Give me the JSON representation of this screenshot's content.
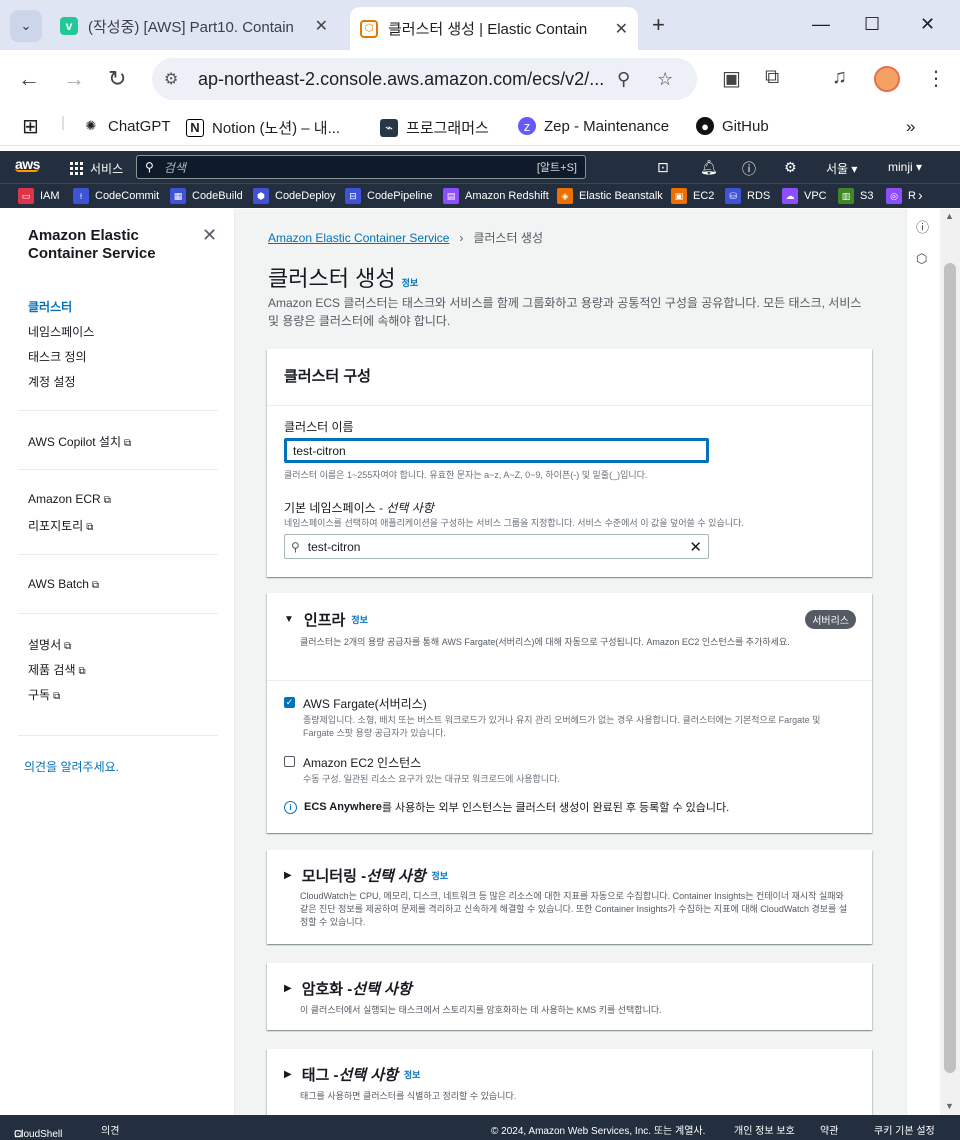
{
  "browser": {
    "tabs": [
      {
        "label": "(작성중) [AWS] Part10. Contain",
        "favicon": "velog-icon"
      },
      {
        "label": "클러스터 생성 | Elastic Contain",
        "favicon": "ecs-icon"
      }
    ],
    "url": "ap-northeast-2.console.aws.amazon.com/ecs/v2/...",
    "bookmarks": [
      "ChatGPT",
      "Notion (노션) – 내...",
      "프로그래머스",
      "Zep - Maintenance",
      "GitHub"
    ]
  },
  "aws_nav": {
    "logo": "aws",
    "services_label": "서비스",
    "search_placeholder": "검색",
    "search_shortcut": "[알트+S]",
    "region": "서울 ▾",
    "user": "minji ▾",
    "favorites": [
      "IAM",
      "CodeCommit",
      "CodeBuild",
      "CodeDeploy",
      "CodePipeline",
      "Amazon Redshift",
      "Elastic Beanstalk",
      "EC2",
      "RDS",
      "VPC",
      "S3",
      "R"
    ]
  },
  "sidenav": {
    "title": "Amazon Elastic Container Service",
    "items": [
      {
        "label": "클러스터",
        "active": true
      },
      {
        "label": "네임스페이스"
      },
      {
        "label": "태스크 정의"
      },
      {
        "label": "계정 설정"
      }
    ],
    "copilot": "AWS Copilot 설치",
    "ecr": "Amazon ECR",
    "repos": "리포지토리",
    "batch": "AWS Batch",
    "docs": "설명서",
    "product_search": "제품 검색",
    "subscribe": "구독",
    "feedback": "의견을 알려주세요."
  },
  "main": {
    "breadcrumb_root": "Amazon Elastic Container Service",
    "breadcrumb_current": "클러스터 생성",
    "title": "클러스터 생성",
    "info": "정보",
    "description": "Amazon ECS 클러스터는 태스크와 서비스를 함께 그룹화하고 용량과 공통적인 구성을 공유합니다. 모든 태스크, 서비스 및 용량은 클러스터에 속해야 합니다.",
    "config": {
      "header": "클러스터 구성",
      "name_label": "클러스터 이름",
      "name_value": "test-citron",
      "name_hint": "클러스터 이름은 1~255자여야 합니다. 유효한 문자는 a~z, A~Z, 0~9, 하이픈(-) 및 밑줄(_)입니다.",
      "ns_label": "기본 네임스페이스 - ",
      "ns_optional": "선택 사항",
      "ns_hint": "네임스페이스를 선택하여 애플리케이션을 구성하는 서비스 그룹을 지정합니다. 서비스 수준에서 이 값을 덮어쓸 수 있습니다.",
      "ns_value": "test-citron"
    },
    "infra": {
      "header": "인프라",
      "badge": "서버리스",
      "description": "클러스터는 2개의 용량 공급자를 통해 AWS Fargate(서버리스)에 대해 자동으로 구성됩니다. Amazon EC2 인스턴스를 추가하세요.",
      "fargate_label": "AWS Fargate(서버리스)",
      "fargate_checked": true,
      "fargate_desc": "종량제입니다. 소형, 배치 또는 버스트 워크로드가 있거나 유지 관리 오버헤드가 없는 경우 사용합니다. 클러스터에는 기본적으로 Fargate 및 Fargate 스팟 용량 공급자가 있습니다.",
      "ec2_label": "Amazon EC2 인스턴스",
      "ec2_checked": false,
      "ec2_desc": "수동 구성. 일관된 리소스 요구가 있는 대규모 워크로드에 사용합니다.",
      "anywhere_bold": "ECS Anywhere",
      "anywhere_rest": "를 사용하는 외부 인스턴스는 클러스터 생성이 완료된 후 등록할 수 있습니다."
    },
    "monitoring": {
      "header": "모니터링 - ",
      "optional": "선택 사항",
      "description": "CloudWatch는 CPU, 메모리, 디스크, 네트워크 등 많은 리소스에 대한 지표를 자동으로 수집합니다. Container Insights는 컨테이너 재시작 실패와 같은 진단 정보를 제공하여 문제를 격리하고 신속하게 해결할 수 있습니다. 또한 Container Insights가 수집하는 지표에 대해 CloudWatch 경보를 설정할 수 있습니다."
    },
    "encryption": {
      "header": "암호화 - ",
      "optional": "선택 사항",
      "description": "이 클러스터에서 실행되는 태스크에서 스토리지를 암호화하는 데 사용하는 KMS 키를 선택합니다."
    },
    "tags": {
      "header": "태그 - ",
      "optional": "선택 사항",
      "description": "태그를 사용하면 클러스터를 식별하고 정리할 수 있습니다."
    }
  },
  "footer": {
    "cloudshell": "CloudShell",
    "feedback": "의견",
    "copyright": "© 2024, Amazon Web Services, Inc. 또는 계열사.",
    "privacy": "개인 정보 보호",
    "terms": "약관",
    "cookies": "쿠키 기본 설정"
  }
}
